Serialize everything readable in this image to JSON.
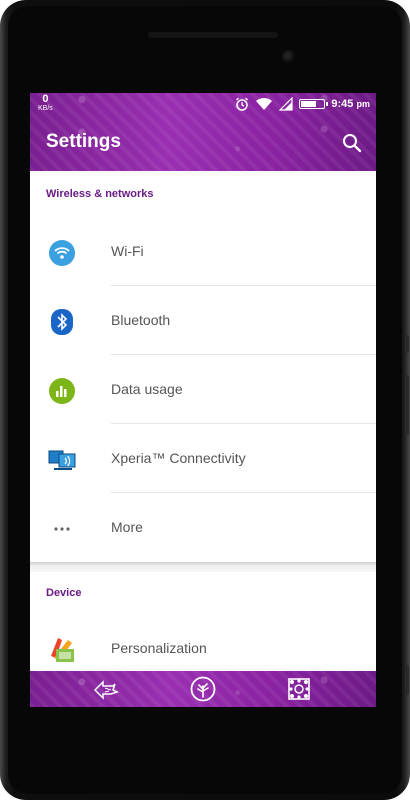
{
  "statusbar": {
    "speed_value": "0",
    "speed_unit": "KB/s",
    "time": "9:45",
    "time_suffix": "pm",
    "battery_level": 0.7,
    "icons": [
      "alarm-icon",
      "wifi-signal-icon",
      "cell-signal-icon",
      "battery-icon"
    ]
  },
  "appbar": {
    "title": "Settings",
    "search_icon": "search-icon"
  },
  "sections": [
    {
      "header": "Wireless & networks",
      "items": [
        {
          "label": "Wi-Fi",
          "icon": "wifi-icon"
        },
        {
          "label": "Bluetooth",
          "icon": "bluetooth-icon"
        },
        {
          "label": "Data usage",
          "icon": "data-usage-icon"
        },
        {
          "label": "Xperia™ Connectivity",
          "icon": "xperia-connectivity-icon"
        },
        {
          "label": "More",
          "icon": "more-dots-icon"
        }
      ]
    },
    {
      "header": "Device",
      "items": [
        {
          "label": "Personalization",
          "icon": "personalization-icon"
        }
      ]
    }
  ],
  "navbar": {
    "buttons": [
      "back-button",
      "home-button",
      "recents-button"
    ]
  },
  "colors": {
    "theme_purple": "#8a22a2",
    "section_header": "#6a1b86",
    "item_text": "#555555",
    "wifi_blue": "#3aa0e0",
    "bluetooth_blue": "#1a66c8",
    "data_green": "#7cb518"
  }
}
